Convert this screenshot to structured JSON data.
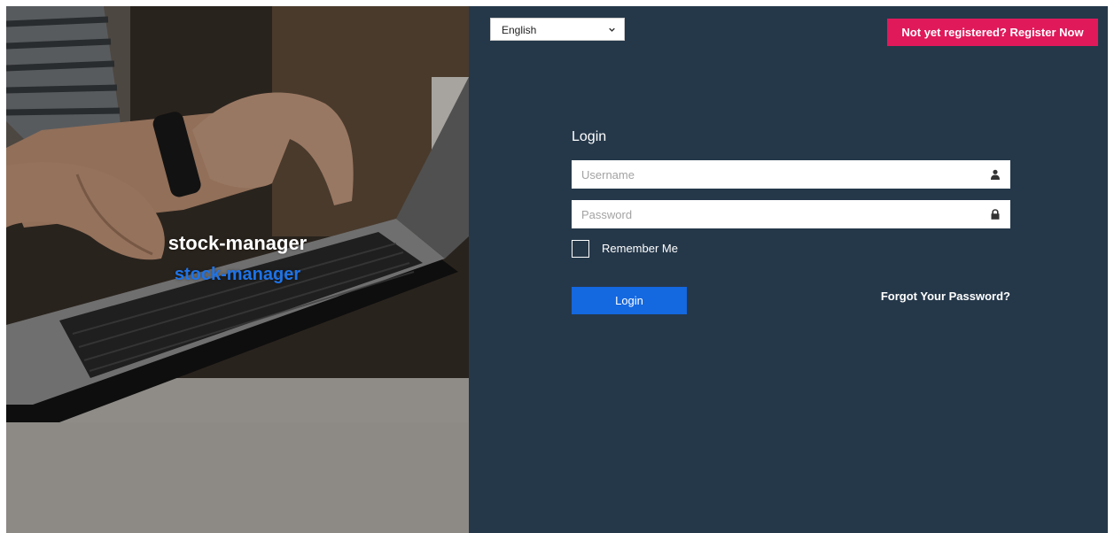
{
  "brand": {
    "title": "stock-manager",
    "subtitle": "stock-manager"
  },
  "language": {
    "selected": "English"
  },
  "register_button": "Not yet registered? Register Now",
  "login_form": {
    "title": "Login",
    "username_placeholder": "Username",
    "password_placeholder": "Password",
    "remember_label": "Remember Me",
    "login_button": "Login",
    "forgot_link": "Forgot Your Password?"
  },
  "icons": {
    "username": "user-icon",
    "password": "lock-icon",
    "language_dropdown": "chevron-down-icon"
  },
  "colors": {
    "panel_bg": "#25384a",
    "register_bg": "#e0195b",
    "login_bg": "#1468e0",
    "brand_accent": "#1e73e8"
  }
}
